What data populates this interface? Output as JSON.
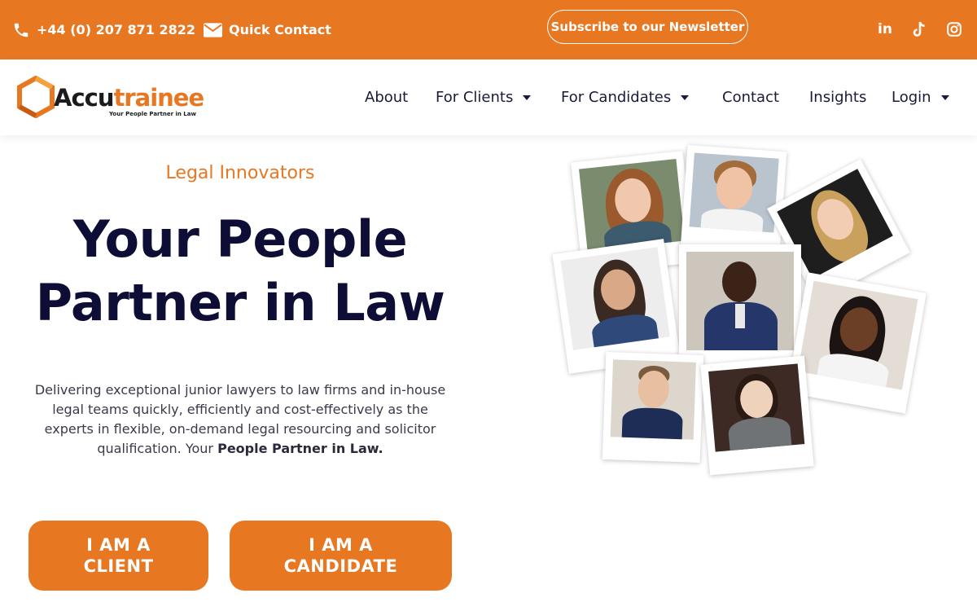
{
  "topbar": {
    "phone": "+44 (0) 207 871 2822",
    "quick_contact": "Quick Contact",
    "newsletter": "Subscribe to our Newsletter"
  },
  "brand": {
    "name_part1": "Accu",
    "name_part2": "trainee",
    "tagline": "Your People Partner in Law"
  },
  "nav": {
    "about": "About",
    "for_clients": "For Clients",
    "for_candidates": "For Candidates",
    "contact": "Contact",
    "insights": "Insights",
    "login": "Login"
  },
  "hero": {
    "eyebrow": "Legal Innovators",
    "title_line1": "Your People",
    "title_line2": "Partner in Law",
    "description": "Delivering exceptional junior lawyers to law firms and in-house legal teams quickly, efficiently and cost-effectively as the experts in flexible, on-demand legal resourcing and solicitor qualification. Your ",
    "description_bold": "People Partner in Law.",
    "btn_client_line1": "I AM A",
    "btn_client_line2": "CLIENT",
    "btn_candidate_line1": "I AM A",
    "btn_candidate_line2": "CANDIDATE"
  },
  "colors": {
    "brand_orange": "#E87722",
    "navy": "#0d0d35"
  },
  "icons": {
    "phone": "phone-icon",
    "envelope": "envelope-icon",
    "linkedin": "linkedin-icon",
    "tiktok": "tiktok-icon",
    "instagram": "instagram-icon"
  }
}
